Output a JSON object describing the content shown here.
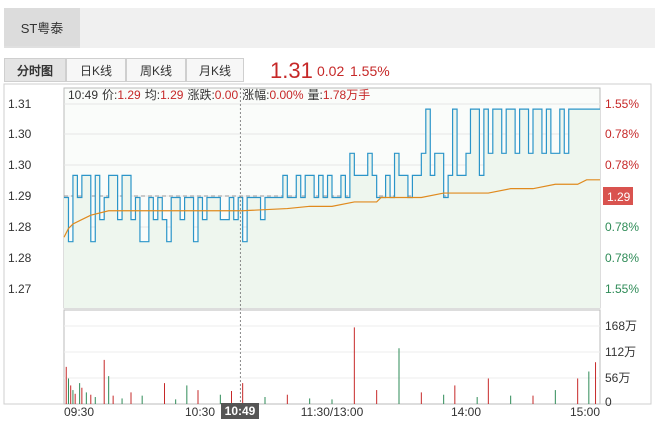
{
  "stock_tab": "ST粤泰",
  "tabs": [
    {
      "label": "分时图",
      "active": true
    },
    {
      "label": "日K线",
      "active": false
    },
    {
      "label": "周K线",
      "active": false
    },
    {
      "label": "月K线",
      "active": false
    }
  ],
  "quote": {
    "price": "1.31",
    "change": "0.02",
    "change_pct": "1.55%"
  },
  "info_bar": {
    "time": "10:49",
    "price_label": "价:",
    "price": "1.29",
    "avg_label": "均:",
    "avg": "1.29",
    "change_label": "涨跌:",
    "change": "0.00",
    "pct_label": "涨幅:",
    "pct": "0.00%",
    "vol_label": "量:",
    "vol": "1.78万手"
  },
  "colors": {
    "up": "#c62828",
    "down": "#2e8b57",
    "price_line": "#2b95c9",
    "avg_line": "#e08a1e",
    "fill": "#eef6ee"
  },
  "chart_data": {
    "type": "line",
    "title": "",
    "x_ticks": [
      "09:30",
      "10:30",
      "11:30/13:00",
      "14:00",
      "15:00"
    ],
    "crosshair_time": "10:49",
    "ylim": [
      1.265,
      1.315
    ],
    "y_ticks_left": [
      "1.31",
      "1.30",
      "1.30",
      "1.29",
      "1.28",
      "1.28",
      "1.27"
    ],
    "y_ticks_right": [
      {
        "label": "1.55%",
        "color": "up"
      },
      {
        "label": "0.78%",
        "color": "up"
      },
      {
        "label": "0.78%",
        "color": "up"
      },
      {
        "label": "1.29",
        "color": "badge"
      },
      {
        "label": "0.78%",
        "color": "down"
      },
      {
        "label": "0.78%",
        "color": "down"
      },
      {
        "label": "1.55%",
        "color": "down"
      }
    ],
    "prev_close": 1.29,
    "series": [
      {
        "name": "价",
        "x": [
          0,
          2,
          4,
          6,
          8,
          12,
          14,
          16,
          18,
          20,
          24,
          26,
          30,
          32,
          34,
          38,
          40,
          42,
          44,
          46,
          48,
          52,
          54,
          58,
          60,
          62,
          64,
          68,
          70,
          74,
          76,
          78,
          80,
          82,
          86,
          88,
          90,
          94,
          98,
          100,
          104,
          106,
          108,
          112,
          114,
          116,
          118,
          120,
          124,
          126,
          128,
          130,
          134,
          136,
          138,
          140,
          144,
          146,
          148,
          150,
          154,
          156,
          160,
          162,
          164,
          166,
          170,
          172,
          174,
          176,
          180,
          182,
          186,
          188,
          190,
          192,
          196,
          198,
          202,
          204,
          208,
          210,
          214,
          216,
          218,
          222,
          224,
          226,
          230,
          232,
          234,
          236,
          240
        ],
        "values": [
          1.29,
          1.28,
          1.295,
          1.29,
          1.295,
          1.28,
          1.295,
          1.285,
          1.29,
          1.295,
          1.285,
          1.295,
          1.285,
          1.29,
          1.28,
          1.29,
          1.285,
          1.29,
          1.285,
          1.28,
          1.29,
          1.285,
          1.29,
          1.28,
          1.29,
          1.285,
          1.29,
          1.29,
          1.285,
          1.29,
          1.285,
          1.29,
          1.28,
          1.29,
          1.29,
          1.285,
          1.29,
          1.29,
          1.295,
          1.29,
          1.295,
          1.29,
          1.295,
          1.29,
          1.295,
          1.29,
          1.295,
          1.29,
          1.295,
          1.29,
          1.3,
          1.295,
          1.295,
          1.3,
          1.295,
          1.29,
          1.295,
          1.29,
          1.3,
          1.295,
          1.29,
          1.295,
          1.3,
          1.31,
          1.295,
          1.3,
          1.29,
          1.295,
          1.31,
          1.295,
          1.3,
          1.31,
          1.295,
          1.31,
          1.3,
          1.31,
          1.3,
          1.31,
          1.3,
          1.31,
          1.3,
          1.31,
          1.3,
          1.31,
          1.3,
          1.31,
          1.3,
          1.31,
          1.31,
          1.31,
          1.31,
          1.31,
          1.31
        ]
      },
      {
        "name": "均",
        "x": [
          0,
          2,
          4,
          8,
          12,
          20,
          30,
          40,
          60,
          80,
          100,
          110,
          120,
          130,
          140,
          142,
          150,
          160,
          170,
          180,
          190,
          200,
          210,
          220,
          230,
          234,
          240
        ],
        "values": [
          1.281,
          1.283,
          1.284,
          1.285,
          1.286,
          1.287,
          1.287,
          1.287,
          1.287,
          1.287,
          1.2875,
          1.288,
          1.288,
          1.289,
          1.289,
          1.29,
          1.29,
          1.29,
          1.291,
          1.291,
          1.291,
          1.292,
          1.292,
          1.293,
          1.293,
          1.294,
          1.294
        ]
      }
    ],
    "volume": {
      "y_ticks": [
        "168万",
        "112万",
        "56万",
        "0"
      ],
      "max": 168,
      "bars_up": [
        [
          1,
          80
        ],
        [
          3,
          40
        ],
        [
          5,
          22
        ],
        [
          8,
          35
        ],
        [
          12,
          20
        ],
        [
          18,
          95
        ],
        [
          22,
          18
        ],
        [
          30,
          25
        ],
        [
          45,
          45
        ],
        [
          60,
          30
        ],
        [
          75,
          28
        ],
        [
          80,
          45
        ],
        [
          100,
          20
        ],
        [
          130,
          165
        ],
        [
          140,
          30
        ],
        [
          160,
          25
        ],
        [
          175,
          40
        ],
        [
          190,
          55
        ],
        [
          210,
          18
        ],
        [
          230,
          55
        ],
        [
          238,
          90
        ]
      ],
      "bars_down": [
        [
          2,
          55
        ],
        [
          4,
          30
        ],
        [
          7,
          45
        ],
        [
          10,
          25
        ],
        [
          14,
          15
        ],
        [
          20,
          60
        ],
        [
          26,
          12
        ],
        [
          35,
          18
        ],
        [
          50,
          10
        ],
        [
          55,
          40
        ],
        [
          70,
          20
        ],
        [
          90,
          15
        ],
        [
          110,
          12
        ],
        [
          120,
          10
        ],
        [
          150,
          120
        ],
        [
          170,
          20
        ],
        [
          185,
          15
        ],
        [
          200,
          18
        ],
        [
          220,
          30
        ],
        [
          235,
          70
        ]
      ]
    }
  }
}
